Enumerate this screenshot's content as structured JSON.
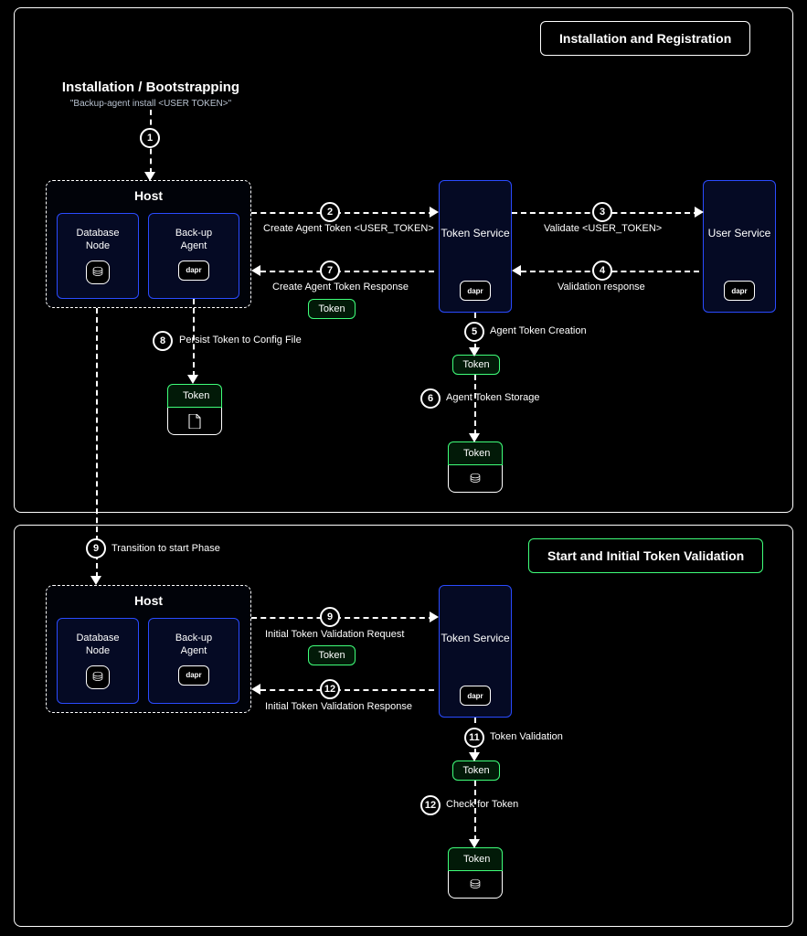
{
  "panel1": {
    "title": "Installation and Registration",
    "section_title": "Installation / Bootstrapping",
    "section_cmd": "\"Backup-agent install <USER TOKEN>\"",
    "host_label": "Host",
    "db_node": "Database\nNode",
    "backup_agent": "Back-up\nAgent",
    "dapr": "dapr",
    "token_service": "Token\nService",
    "user_service": "User\nService",
    "token": "Token",
    "steps": {
      "s1": {
        "num": "1",
        "label": ""
      },
      "s2": {
        "num": "2",
        "label": "Create Agent Token <USER_TOKEN>"
      },
      "s3": {
        "num": "3",
        "label": "Validate  <USER_TOKEN>"
      },
      "s4": {
        "num": "4",
        "label": "Validation response"
      },
      "s5": {
        "num": "5",
        "label": "Agent Token Creation"
      },
      "s6": {
        "num": "6",
        "label": "Agent Token Storage"
      },
      "s7": {
        "num": "7",
        "label": "Create Agent Token Response"
      },
      "s8": {
        "num": "8",
        "label": "Persist Token to Config File"
      }
    }
  },
  "panel2": {
    "title": "Start and Initial Token Validation",
    "host_label": "Host",
    "db_node": "Database\nNode",
    "backup_agent": "Back-up\nAgent",
    "dapr": "dapr",
    "token_service": "Token\nService",
    "token": "Token",
    "steps": {
      "s9a": {
        "num": "9",
        "label": "Transition to start Phase"
      },
      "s9b": {
        "num": "9",
        "label": "Initial Token Validation Request"
      },
      "s11": {
        "num": "11",
        "label": "Token Validation"
      },
      "s12a": {
        "num": "12",
        "label": "Initial Token Validation Response"
      },
      "s12b": {
        "num": "12",
        "label": "Check for Token"
      }
    }
  }
}
